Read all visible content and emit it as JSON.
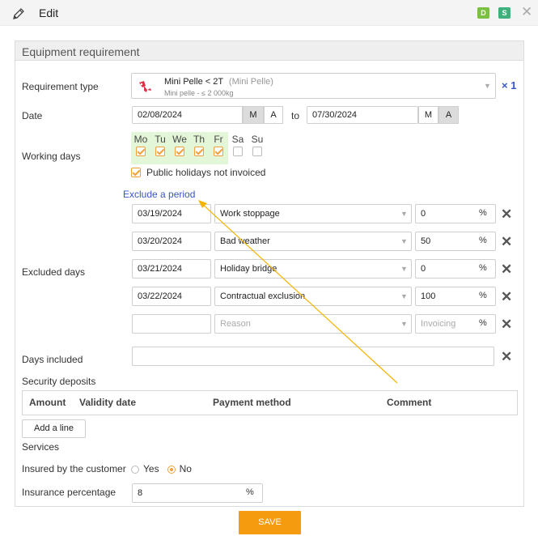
{
  "header": {
    "title": "Edit",
    "badges": [
      {
        "label": "D",
        "color": "#7ac143"
      },
      {
        "label": "S",
        "color": "#3fb07b"
      }
    ],
    "close_label": "✕"
  },
  "panel": {
    "title": "Equipment requirement"
  },
  "requirement_type": {
    "label": "Requirement type",
    "name": "Mini Pelle < 2T",
    "category": "(Mini Pelle)",
    "subtitle": "Mini pelle - ≤ 2 000kg",
    "quantity": "× 1"
  },
  "date": {
    "label": "Date",
    "start": "02/08/2024",
    "start_m": "M",
    "start_a": "A",
    "to_label": "to",
    "end": "07/30/2024",
    "end_m": "M",
    "end_a": "A"
  },
  "working_days": {
    "label": "Working days",
    "days": [
      {
        "label": "Mo",
        "checked": true
      },
      {
        "label": "Tu",
        "checked": true
      },
      {
        "label": "We",
        "checked": true
      },
      {
        "label": "Th",
        "checked": true
      },
      {
        "label": "Fr",
        "checked": true
      },
      {
        "label": "Sa",
        "checked": false
      },
      {
        "label": "Su",
        "checked": false
      }
    ],
    "active_color": "#e3f6d8",
    "holidays_label": "Public holidays not invoiced",
    "holidays_checked": true
  },
  "excluded": {
    "link_label": "Exclude a period",
    "label": "Excluded days",
    "rows": [
      {
        "date": "03/19/2024",
        "reason": "Work stoppage",
        "invoicing": "0",
        "pct": "%"
      },
      {
        "date": "03/20/2024",
        "reason": "Bad weather",
        "invoicing": "50",
        "pct": "%"
      },
      {
        "date": "03/21/2024",
        "reason": "Holiday bridge",
        "invoicing": "0",
        "pct": "%"
      },
      {
        "date": "03/22/2024",
        "reason": "Contractual exclusion",
        "invoicing": "100",
        "pct": "%"
      }
    ],
    "new_row": {
      "reason_placeholder": "Reason",
      "invoicing_placeholder": "Invoicing",
      "pct": "%"
    }
  },
  "days_included": {
    "label": "Days included",
    "value": ""
  },
  "security_deposits": {
    "label": "Security deposits",
    "columns": [
      "Amount",
      "Validity date",
      "Payment method",
      "Comment"
    ],
    "add_button": "Add a line"
  },
  "services": {
    "label": "Services"
  },
  "insured": {
    "label": "Insured by the customer",
    "yes": "Yes",
    "no": "No",
    "selected": "No"
  },
  "insurance": {
    "label": "Insurance percentage",
    "value": "8",
    "pct": "%"
  },
  "actions": {
    "save": "SAVE"
  },
  "annotation": {
    "arrow_color": "#f5b400"
  }
}
